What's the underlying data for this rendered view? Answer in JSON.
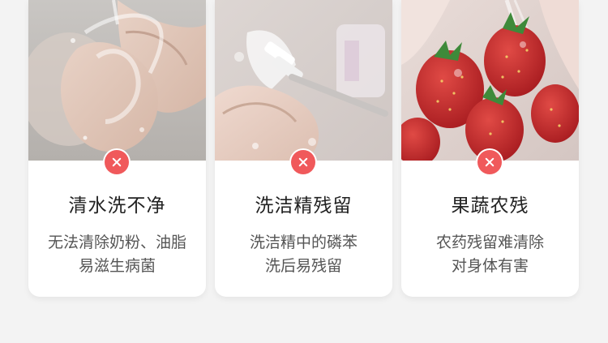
{
  "cards": [
    {
      "title": "清水洗不净",
      "desc_lines": [
        "无法清除奶粉、油脂",
        "易滋生病菌"
      ],
      "status_icon": "close-x-icon"
    },
    {
      "title": "洗洁精残留",
      "desc_lines": [
        "洗洁精中的磷苯",
        "洗后易残留"
      ],
      "status_icon": "close-x-icon"
    },
    {
      "title": "果蔬农残",
      "desc_lines": [
        "农药残留难清除",
        "对身体有害"
      ],
      "status_icon": "close-x-icon"
    }
  ],
  "colors": {
    "background": "#f3f3f3",
    "card": "#ffffff",
    "badge": "#f0595b",
    "title_text": "#222222",
    "desc_text": "#555555"
  }
}
